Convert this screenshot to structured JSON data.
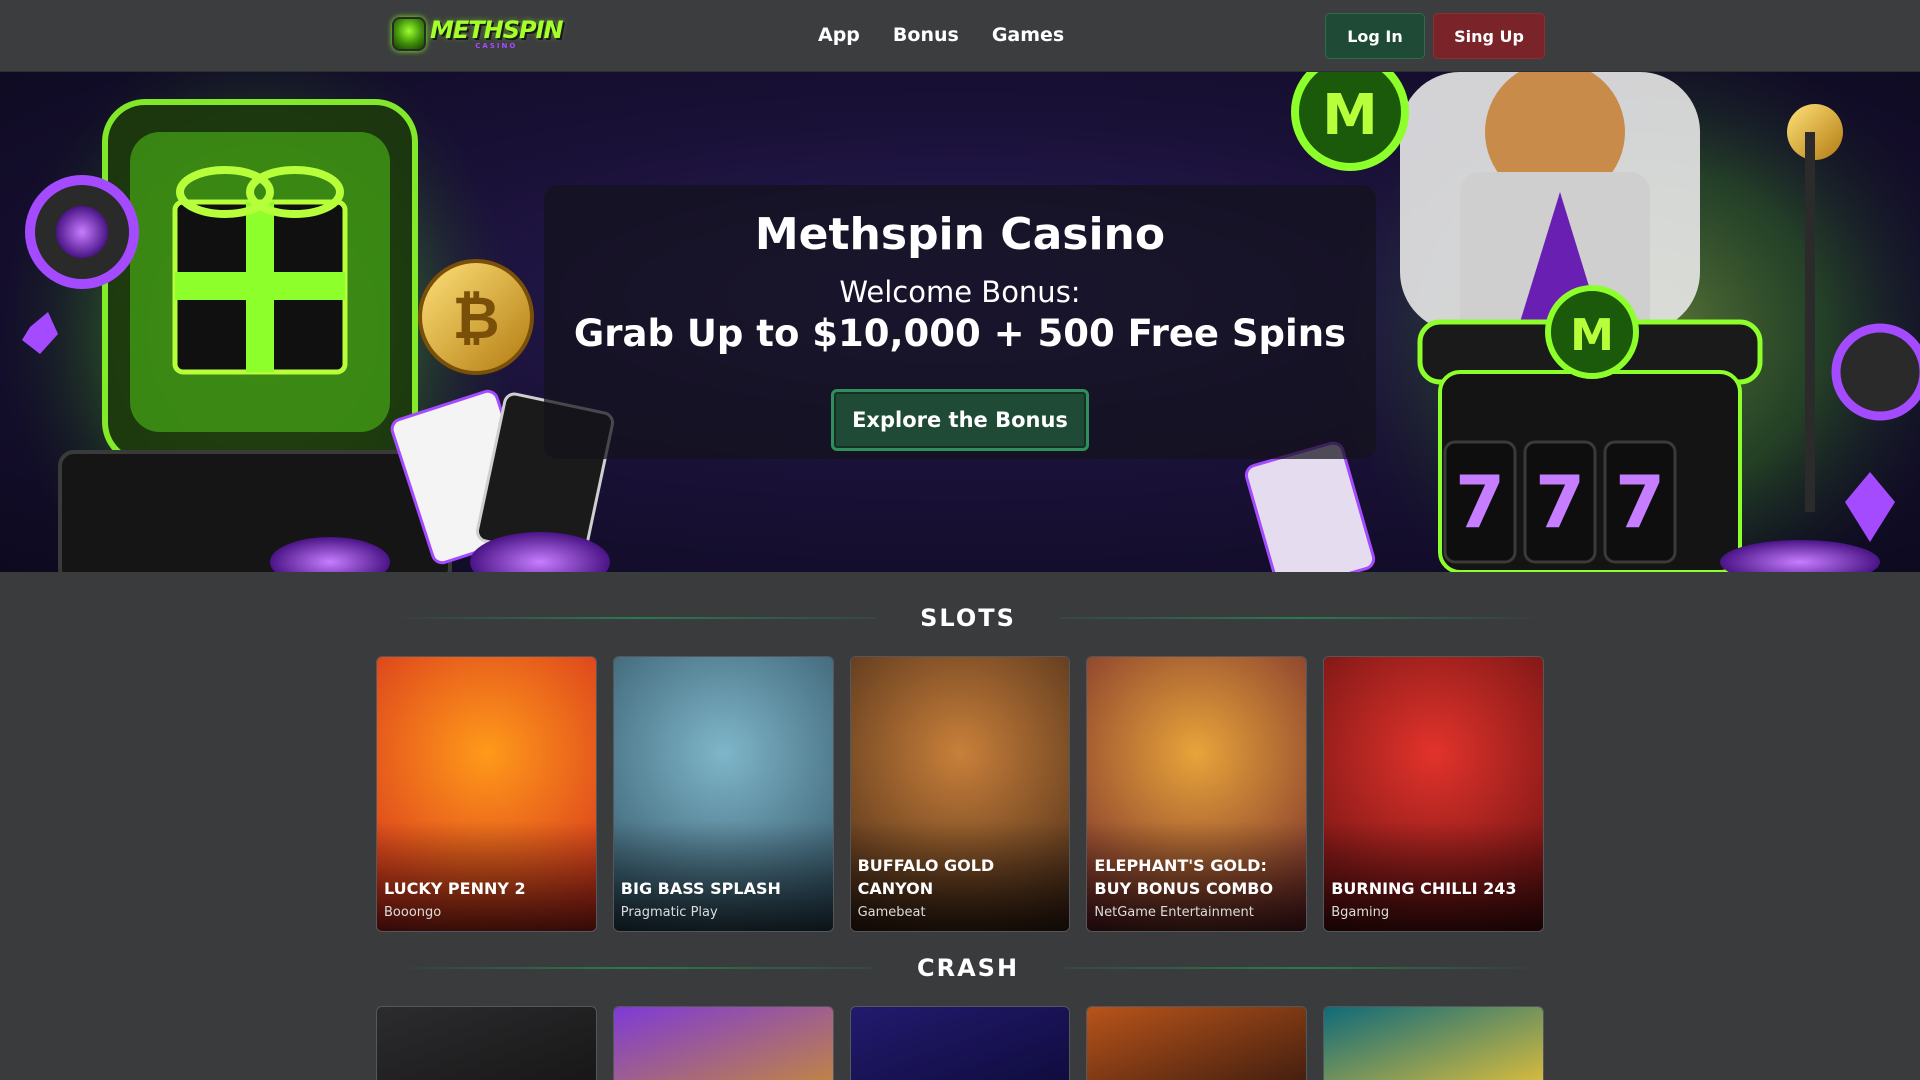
{
  "header": {
    "logo_text": "METHSPIN",
    "logo_sub": "CASINO",
    "nav": [
      {
        "label": "App"
      },
      {
        "label": "Bonus"
      },
      {
        "label": "Games"
      }
    ],
    "login_label": "Log In",
    "signup_label": "Sing Up"
  },
  "hero": {
    "title": "Methspin Casino",
    "subtitle": "Welcome Bonus:",
    "offer": "Grab Up to $10,000 + 500 Free Spins",
    "cta_label": "Explore the Bonus"
  },
  "slots": {
    "title": "SLOTS",
    "games": [
      {
        "name": "LUCKY PENNY 2",
        "provider": "Booongo",
        "colors": [
          "#ff9a1a",
          "#d0241e"
        ]
      },
      {
        "name": "BIG BASS SPLASH",
        "provider": "Pragmatic Play",
        "colors": [
          "#7fb6c9",
          "#2b4b5e"
        ]
      },
      {
        "name": "BUFFALO GOLD CANYON",
        "provider": "Gamebeat",
        "colors": [
          "#c9803a",
          "#3a2214"
        ]
      },
      {
        "name": "ELEPHANT'S GOLD: BUY BONUS COMBO",
        "provider": "NetGame Entertainment",
        "colors": [
          "#e8a43a",
          "#6a1f2a"
        ]
      },
      {
        "name": "BURNING CHILLI 243",
        "provider": "Bgaming",
        "colors": [
          "#e2332b",
          "#5a0d0f"
        ]
      }
    ]
  },
  "crash": {
    "title": "CRASH",
    "games": [
      {
        "colors": [
          "#2c2c2e",
          "#151516"
        ]
      },
      {
        "colors": [
          "#7e3ad6",
          "#c58a3a"
        ]
      },
      {
        "colors": [
          "#221a6e",
          "#0e0b3a"
        ]
      },
      {
        "colors": [
          "#b8541a",
          "#3a1a0e"
        ]
      },
      {
        "colors": [
          "#0f6a7a",
          "#e6c23a"
        ]
      }
    ]
  }
}
